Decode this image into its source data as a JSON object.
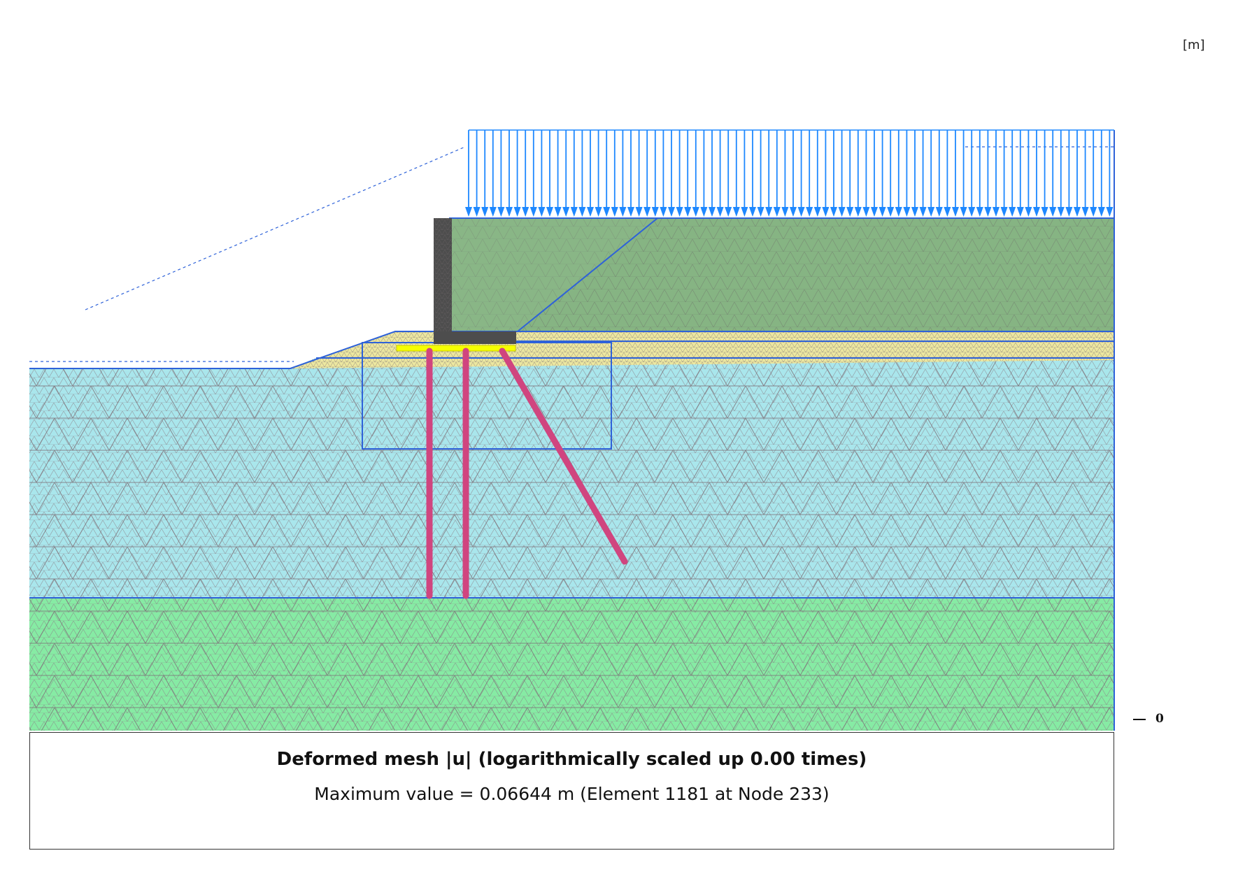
{
  "header": {
    "unit_label": "[m]"
  },
  "scale": {
    "zero_label": "0"
  },
  "caption": {
    "title": "Deformed mesh |u| (logarithmically scaled up 0.00 times)",
    "subtitle": "Maximum value = 0.06644 m (Element 1181 at Node 233)"
  },
  "colors": {
    "bottom_soil": "#86eba4",
    "middle_soil": "#a9e6ec",
    "fill_layer": "#ece7a0",
    "top_fill": "#86b483",
    "wall": "#4d4d4d",
    "pile": "#d0457f",
    "slab": "#f6ff00",
    "load_arrows": "#1e88ff",
    "boundaries": "#2e62d9",
    "mesh_lines": "#8a7f86"
  },
  "icons": [
    "distributed-load-arrows",
    "pile-elements",
    "retaining-wall"
  ]
}
